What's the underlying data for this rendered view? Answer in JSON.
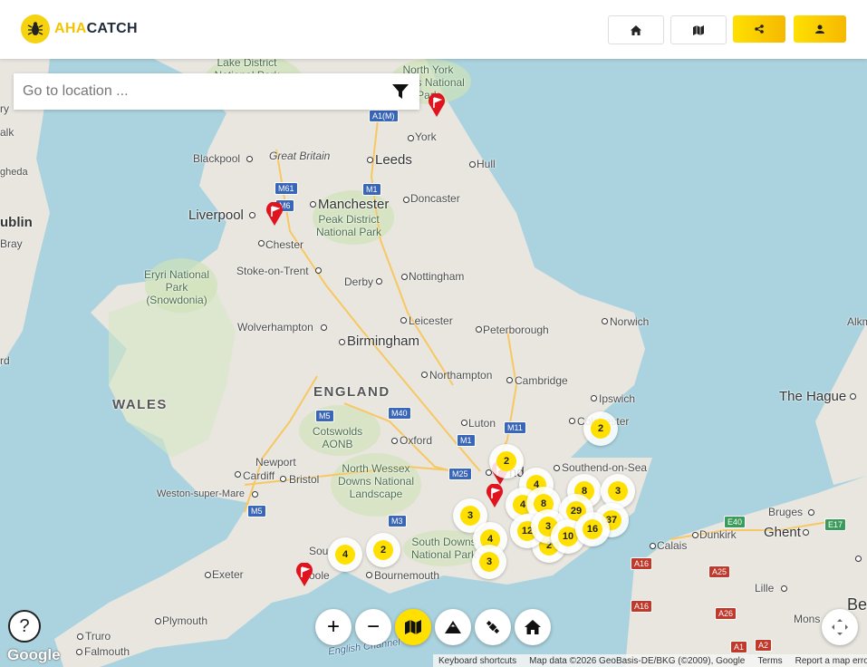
{
  "header": {
    "brand_part1": "AHA",
    "brand_part2": "CATCH"
  },
  "search": {
    "placeholder": "Go to location ..."
  },
  "map": {
    "regions": {
      "england": "ENGLAND",
      "wales": "WALES",
      "great_britain": "Great Britain"
    },
    "cities": {
      "york": "York",
      "leeds": "Leeds",
      "hull": "Hull",
      "blackpool": "Blackpool",
      "doncaster": "Doncaster",
      "manchester": "Manchester",
      "liverpool": "Liverpool",
      "chester": "Chester",
      "stoke": "Stoke-on-Trent",
      "derby": "Derby",
      "nottingham": "Nottingham",
      "wolverhampton": "Wolverhampton",
      "birmingham": "Birmingham",
      "leicester": "Leicester",
      "peterborough": "Peterborough",
      "norwich": "Norwich",
      "northampton": "Northampton",
      "cambridge": "Cambridge",
      "ipswich": "Ipswich",
      "colchester": "Colchester",
      "luton": "Luton",
      "oxford": "Oxford",
      "newport": "Newport",
      "cardiff": "Cardiff",
      "bristol": "Bristol",
      "weston": "Weston-super-Mare",
      "southend": "Southend-on-Sea",
      "southampton": "Sou",
      "bournemouth": "Bournemouth",
      "poole": "oole",
      "exeter": "Exeter",
      "plymouth": "Plymouth",
      "truro": "Truro",
      "falmouth": "Falmouth",
      "calais": "Calais",
      "dunkirk": "Dunkirk",
      "bruges": "Bruges",
      "ghent": "Ghent",
      "lille": "Lille",
      "mons": "Mons",
      "the_hague": "The Hague",
      "dublin": "ublin",
      "bray": "Bray",
      "alkmaar": "Alkm",
      "london": "nd",
      "edge_ry": "ry",
      "edge_alk": "alk",
      "edge_ghed": "gheda",
      "edge_rd": "rd",
      "edge_be": "Be"
    },
    "parks": {
      "lake_district": "Lake District National Park",
      "north_york_moors": "North York Moors National Park",
      "peak_district": "Peak District National Park",
      "eryri": "Eryri National Park (Snowdonia)",
      "cotswolds": "Cotswolds AONB",
      "wessex": "North Wessex Downs National Landscape",
      "south_downs": "South Downs National Park"
    },
    "water": {
      "english_channel": "English Channel"
    },
    "roads": [
      "A1(M)",
      "M61",
      "M1",
      "M6",
      "M5",
      "M40",
      "M11",
      "M1",
      "M25",
      "M3",
      "M5",
      "E40",
      "E17",
      "A16",
      "A25",
      "A16",
      "A26",
      "A1",
      "A2"
    ],
    "clusters": [
      "2",
      "4",
      "8",
      "3",
      "3",
      "4",
      "12",
      "3",
      "29",
      "8",
      "2",
      "10",
      "16",
      "37",
      "4",
      "2",
      "3",
      "4",
      "2"
    ],
    "pins": 5
  },
  "controls": {
    "help": "?",
    "zoom_in": "+",
    "zoom_out": "−"
  },
  "google": "Google",
  "attribution": {
    "shortcuts": "Keyboard shortcuts",
    "mapdata": "Map data ©2026 GeoBasis-DE/BKG (©2009), Google",
    "terms": "Terms",
    "report": "Report a map error"
  },
  "colors": {
    "accent": "#ffe000",
    "pin": "#e0141e",
    "land": "#e8e6df",
    "sea": "#aad3df",
    "green": "#cfe3b8"
  }
}
